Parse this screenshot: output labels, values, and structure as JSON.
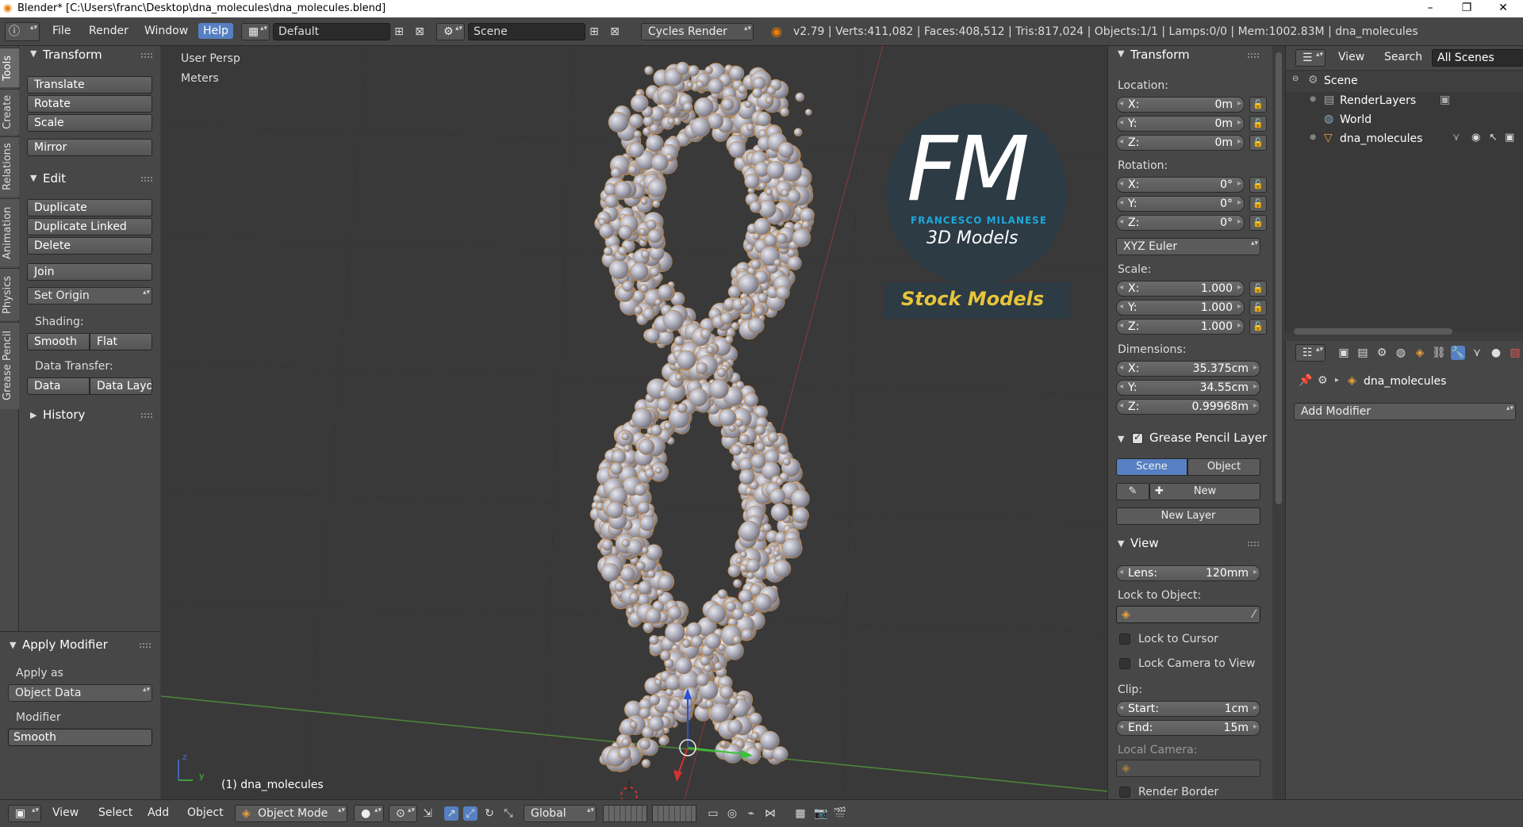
{
  "window": {
    "title": "Blender* [C:\\Users\\franc\\Desktop\\dna_molecules\\dna_molecules.blend]",
    "minimize": "–",
    "restore": "❐",
    "close": "✕"
  },
  "infobar": {
    "menus": [
      "File",
      "Render",
      "Window",
      "Help"
    ],
    "active_menu": "Help",
    "screen_layout": "Default",
    "scene": "Scene",
    "render_engine": "Cycles Render",
    "stats": "v2.79 | Verts:411,082 | Faces:408,512 | Tris:817,024 | Objects:1/1 | Lamps:0/0 | Mem:1002.83M | dna_molecules"
  },
  "tool_tabs": [
    "Tools",
    "Create",
    "Relations",
    "Animation",
    "Physics",
    "Grease Pencil"
  ],
  "toolshelf": {
    "transform": {
      "title": "Transform",
      "buttons": [
        "Translate",
        "Rotate",
        "Scale",
        "Mirror"
      ]
    },
    "edit": {
      "title": "Edit",
      "buttons": [
        "Duplicate",
        "Duplicate Linked",
        "Delete",
        "Join"
      ],
      "set_origin": "Set Origin",
      "shading_label": "Shading:",
      "smooth": "Smooth",
      "flat": "Flat",
      "data_transfer_label": "Data Transfer:",
      "data": "Data",
      "data_layout": "Data Layo"
    },
    "history": "History",
    "apply_modifier": {
      "title": "Apply Modifier",
      "apply_as_label": "Apply as",
      "apply_as_value": "Object Data",
      "modifier_label": "Modifier",
      "modifier_value": "Smooth"
    }
  },
  "viewport": {
    "view_name": "User Persp",
    "units": "Meters",
    "object_label": "(1) dna_molecules",
    "watermark": {
      "initials": "FM",
      "name": "FRANCESCO MILANESE",
      "tagline": "3D Models",
      "stock": "Stock Models"
    },
    "axis_z": "z",
    "axis_y": "y"
  },
  "npanel": {
    "transform_title": "Transform",
    "location_label": "Location:",
    "location": [
      {
        "k": "X:",
        "v": "0m"
      },
      {
        "k": "Y:",
        "v": "0m"
      },
      {
        "k": "Z:",
        "v": "0m"
      }
    ],
    "rotation_label": "Rotation:",
    "rotation": [
      {
        "k": "X:",
        "v": "0°"
      },
      {
        "k": "Y:",
        "v": "0°"
      },
      {
        "k": "Z:",
        "v": "0°"
      }
    ],
    "rotation_mode": "XYZ Euler",
    "scale_label": "Scale:",
    "scale": [
      {
        "k": "X:",
        "v": "1.000"
      },
      {
        "k": "Y:",
        "v": "1.000"
      },
      {
        "k": "Z:",
        "v": "1.000"
      }
    ],
    "dimensions_label": "Dimensions:",
    "dimensions": [
      {
        "k": "X:",
        "v": "35.375cm"
      },
      {
        "k": "Y:",
        "v": "34.55cm"
      },
      {
        "k": "Z:",
        "v": "0.99968m"
      }
    ],
    "grease_title": "Grease Pencil Layer",
    "scene_btn": "Scene",
    "object_btn": "Object",
    "new_btn": "New",
    "new_layer_btn": "New Layer",
    "view_title": "View",
    "lens": {
      "k": "Lens:",
      "v": "120mm"
    },
    "lock_to_object_label": "Lock to Object:",
    "lock_to_cursor": "Lock to Cursor",
    "lock_camera": "Lock Camera to View",
    "clip_label": "Clip:",
    "clip_start": {
      "k": "Start:",
      "v": "1cm"
    },
    "clip_end": {
      "k": "End:",
      "v": "15m"
    },
    "local_camera_label": "Local Camera:",
    "render_border": "Render Border"
  },
  "outliner": {
    "view": "View",
    "search": "Search",
    "all_scenes": "All Scenes",
    "items": [
      "Scene",
      "RenderLayers",
      "World",
      "dna_molecules"
    ]
  },
  "properties": {
    "object_name": "dna_molecules",
    "add_modifier": "Add Modifier"
  },
  "bottombar": {
    "menus": [
      "View",
      "Select",
      "Add",
      "Object"
    ],
    "mode": "Object Mode",
    "orientation": "Global"
  }
}
